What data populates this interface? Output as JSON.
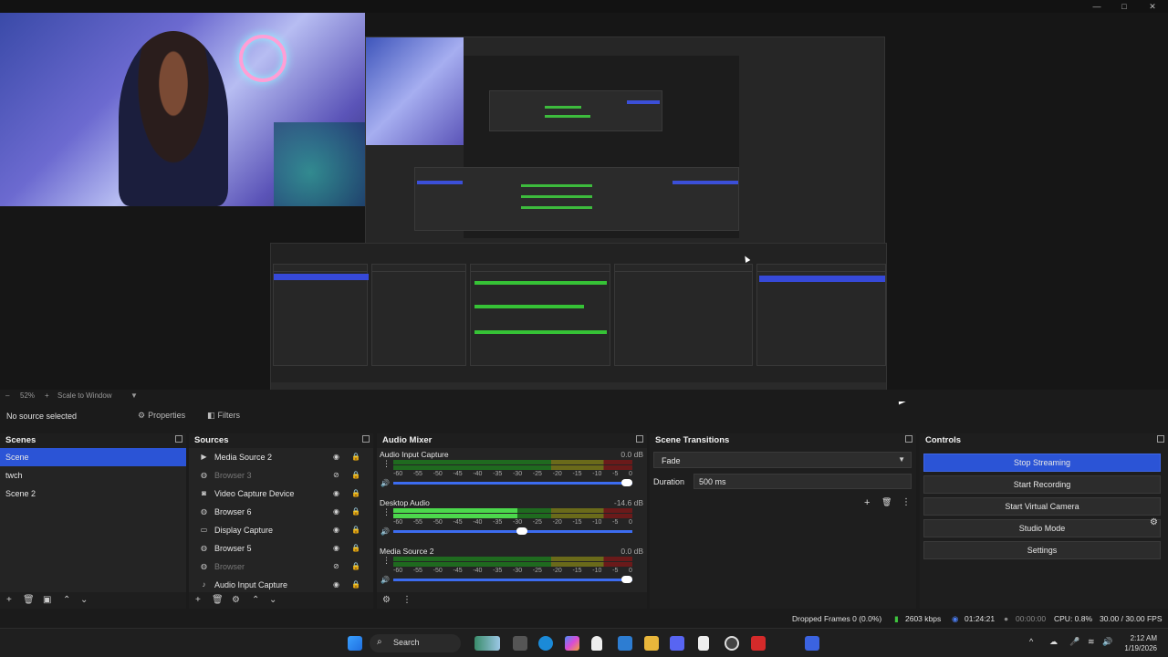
{
  "window": {
    "minimize": "—",
    "maximize": "□",
    "close": "✕"
  },
  "zoom": {
    "level": "52%",
    "mode": "Scale to Window"
  },
  "source_toolbar": {
    "selection": "No source selected",
    "properties": "Properties",
    "filters": "Filters"
  },
  "scenes": {
    "title": "Scenes",
    "items": [
      "Scene",
      "twch",
      "Scene 2"
    ],
    "selected": 0
  },
  "sources": {
    "title": "Sources",
    "items": [
      {
        "label": "Media Source 2",
        "icon": "play-icon",
        "dim": false
      },
      {
        "label": "Browser 3",
        "icon": "globe-icon",
        "dim": true
      },
      {
        "label": "Video Capture Device",
        "icon": "camera-icon",
        "dim": false
      },
      {
        "label": "Browser 6",
        "icon": "globe-icon",
        "dim": false
      },
      {
        "label": "Display Capture",
        "icon": "monitor-icon",
        "dim": false
      },
      {
        "label": "Browser 5",
        "icon": "globe-icon",
        "dim": false
      },
      {
        "label": "Browser",
        "icon": "globe-icon",
        "dim": true
      },
      {
        "label": "Audio Input Capture",
        "icon": "mic-icon",
        "dim": false
      }
    ]
  },
  "audio_mixer": {
    "title": "Audio Mixer",
    "ticks": [
      "-60",
      "-55",
      "-50",
      "-45",
      "-40",
      "-35",
      "-30",
      "-25",
      "-20",
      "-15",
      "-10",
      "-5",
      "0"
    ],
    "channels": [
      {
        "name": "Audio Input Capture",
        "db": "0.0 dB",
        "level": 0.0,
        "volume": 1.0
      },
      {
        "name": "Desktop Audio",
        "db": "-14.6 dB",
        "level": 0.52,
        "volume": 0.56
      },
      {
        "name": "Media Source 2",
        "db": "0.0 dB",
        "level": 0.0,
        "volume": 1.0
      }
    ]
  },
  "scene_transitions": {
    "title": "Scene Transitions",
    "transition": "Fade",
    "duration_label": "Duration",
    "duration_value": "500 ms"
  },
  "controls": {
    "title": "Controls",
    "buttons": [
      "Stop Streaming",
      "Start Recording",
      "Start Virtual Camera",
      "Studio Mode",
      "Settings"
    ]
  },
  "status": {
    "dropped_frames": "Dropped Frames 0 (0.0%)",
    "bitrate": "2603 kbps",
    "stream_time": "01:24:21",
    "record_time": "00:00:00",
    "cpu": "CPU: 0.8%",
    "fps": "30.00 / 30.00 FPS"
  },
  "taskbar": {
    "search": "Search",
    "time": "2:12 AM",
    "date": "1/19/2026"
  },
  "colors": {
    "accent": "#2b54d6",
    "meter_green": "#4cd84c",
    "bg": "#1e1e1e"
  }
}
